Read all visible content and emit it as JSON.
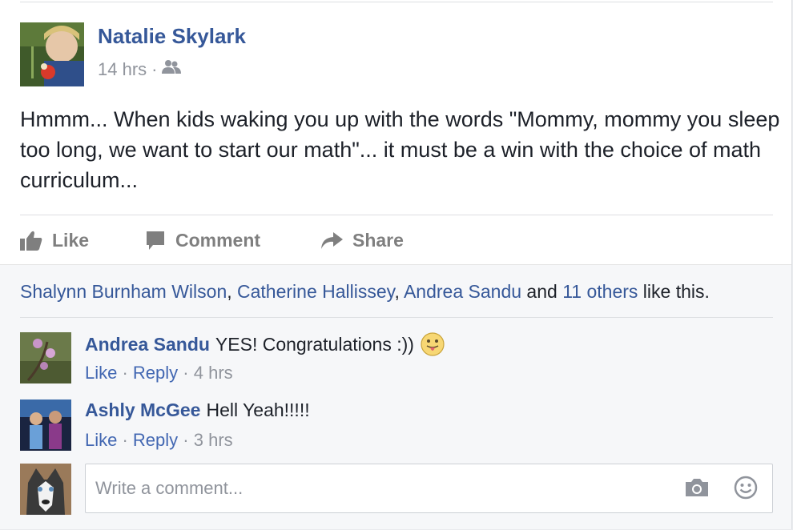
{
  "post": {
    "author": "Natalie Skylark",
    "time": "14 hrs",
    "separator": "·",
    "privacy_icon": "friends-icon",
    "text": "Hmmm... When kids waking you up with the words \"Mommy, mommy you sleep too long, we want to start our math\"... it must be a win with the choice of math curriculum..."
  },
  "actions": {
    "like": "Like",
    "comment": "Comment",
    "share": "Share"
  },
  "likes": {
    "names": [
      "Shalynn Burnham Wilson",
      "Catherine Hallissey",
      "Andrea Sandu"
    ],
    "comma": ", ",
    "and": " and ",
    "others": "11 others",
    "suffix": " like this."
  },
  "comments": [
    {
      "name": "Andrea Sandu",
      "text": "YES! Congratulations :))",
      "emoji": "tongue-emoji",
      "like": "Like",
      "reply": "Reply",
      "sep": " · ",
      "time": "4 hrs"
    },
    {
      "name": "Ashly McGee",
      "text": "Hell Yeah!!!!!",
      "like": "Like",
      "reply": "Reply",
      "sep": " · ",
      "time": "3 hrs"
    }
  ],
  "composer": {
    "placeholder": "Write a comment...",
    "camera_icon": "camera-icon",
    "emoji_icon": "smiley-icon"
  },
  "colors": {
    "link": "#365899",
    "meta": "#90949c",
    "text": "#1d2129",
    "action": "#7f7f7f",
    "ufi_bg": "#f6f7f9"
  }
}
